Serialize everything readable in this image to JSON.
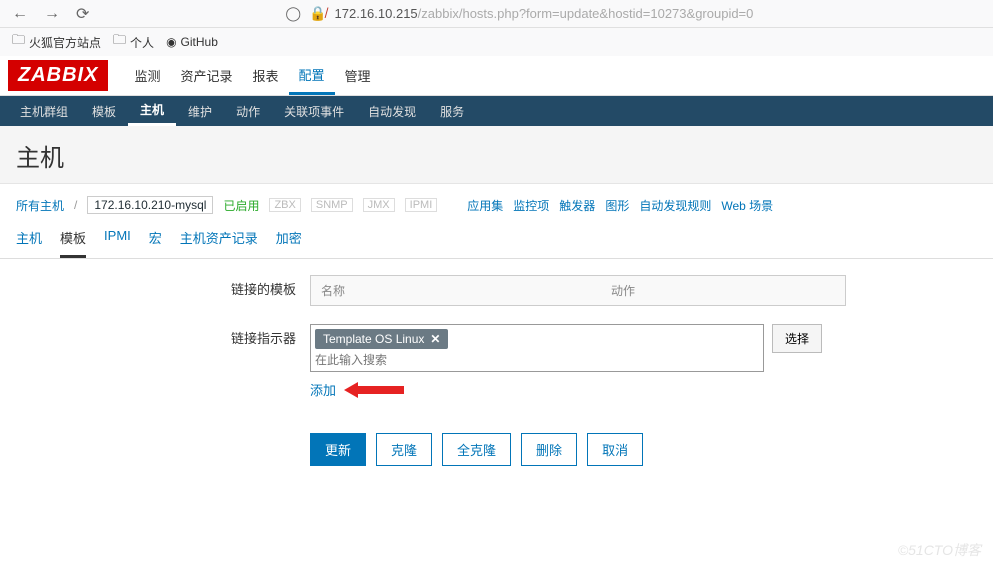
{
  "browser": {
    "url_host": "172.16.10.215",
    "url_path": "/zabbix/hosts.php?form=update&hostid=10273&groupid=0"
  },
  "bookmarks": {
    "items": [
      {
        "label": "火狐官方站点"
      },
      {
        "label": "个人"
      },
      {
        "label": "GitHub"
      }
    ]
  },
  "logo": "ZABBIX",
  "topnav": {
    "items": [
      {
        "label": "监测"
      },
      {
        "label": "资产记录"
      },
      {
        "label": "报表"
      },
      {
        "label": "配置"
      },
      {
        "label": "管理"
      }
    ]
  },
  "subnav": {
    "items": [
      {
        "label": "主机群组"
      },
      {
        "label": "模板"
      },
      {
        "label": "主机"
      },
      {
        "label": "维护"
      },
      {
        "label": "动作"
      },
      {
        "label": "关联项事件"
      },
      {
        "label": "自动发现"
      },
      {
        "label": "服务"
      }
    ]
  },
  "page": {
    "title": "主机"
  },
  "crumbs": {
    "all_hosts": "所有主机",
    "host_name": "172.16.10.210-mysql",
    "enabled": "已启用",
    "tags": [
      "ZBX",
      "SNMP",
      "JMX",
      "IPMI"
    ],
    "links": [
      "应用集",
      "监控项",
      "触发器",
      "图形",
      "自动发现规则",
      "Web 场景"
    ]
  },
  "tabs": {
    "items": [
      {
        "label": "主机"
      },
      {
        "label": "模板"
      },
      {
        "label": "IPMI"
      },
      {
        "label": "宏"
      },
      {
        "label": "主机资产记录"
      },
      {
        "label": "加密"
      }
    ]
  },
  "form": {
    "linked_label": "链接的模板",
    "col_name": "名称",
    "col_action": "动作",
    "indicator_label": "链接指示器",
    "chip": "Template OS Linux",
    "search_placeholder": "在此输入搜索",
    "select_btn": "选择",
    "add_link": "添加"
  },
  "buttons": {
    "update": "更新",
    "clone": "克隆",
    "full_clone": "全克隆",
    "delete": "删除",
    "cancel": "取消"
  },
  "watermark": "©51CTO博客"
}
